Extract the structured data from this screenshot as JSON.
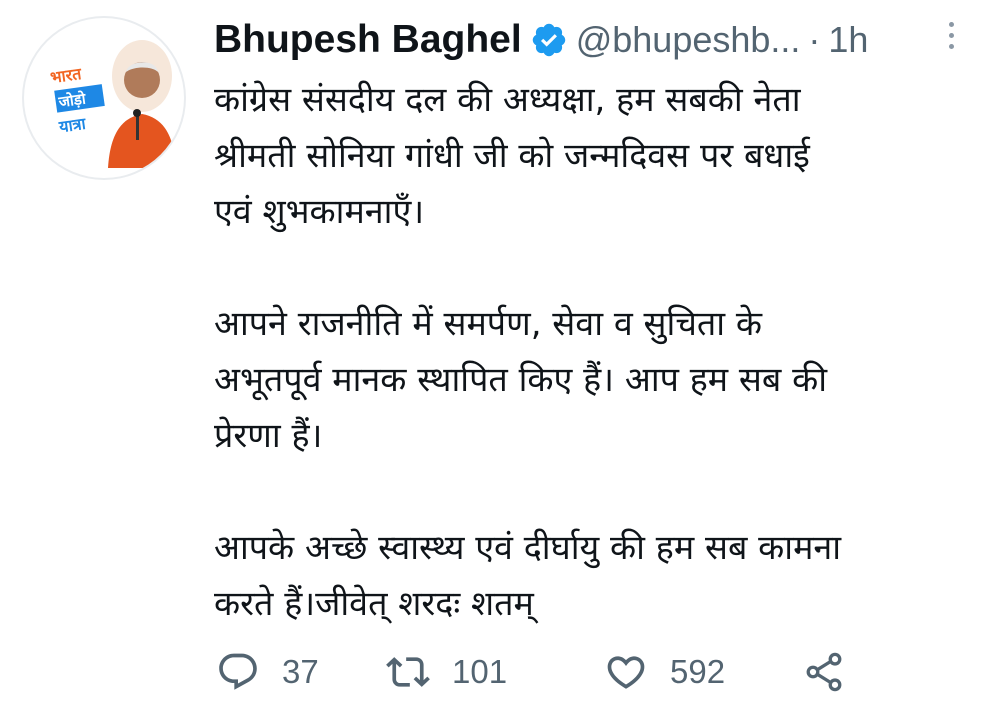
{
  "author": {
    "name": "Bhupesh Baghel",
    "handle": "@bhupeshb...",
    "separator": "·",
    "time": "1h",
    "avatar_badge": [
      "भारत",
      "जोड़ो",
      "यात्रा"
    ]
  },
  "tweet": {
    "paragraphs": [
      [
        "कांग्रेस संसदीय दल की अध्यक्षा, हम सबकी नेता",
        "श्रीमती सोनिया गांधी जी को जन्मदिवस पर बधाई",
        "एवं शुभकामनाएँ।"
      ],
      [
        "आपने राजनीति में समर्पण, सेवा व सुचिता के",
        "अभूतपूर्व मानक स्थापित किए हैं। आप हम सब की",
        "प्रेरणा हैं।"
      ],
      [
        "आपके अच्छे स्वास्थ्य एवं दीर्घायु की हम सब कामना",
        "करते हैं।जीवेत् शरदः शतम्"
      ]
    ]
  },
  "actions": {
    "replies": "37",
    "retweets": "101",
    "likes": "592"
  },
  "icons": {
    "verified": "verified-badge-icon",
    "more": "more-vertical-icon",
    "reply": "reply-icon",
    "retweet": "retweet-icon",
    "like": "heart-icon",
    "share": "share-icon"
  },
  "colors": {
    "verified": "#1d9bf0",
    "muted": "#536471",
    "text": "#0f1419",
    "badge_orange": "#f26522",
    "badge_blue": "#1e88e5"
  }
}
